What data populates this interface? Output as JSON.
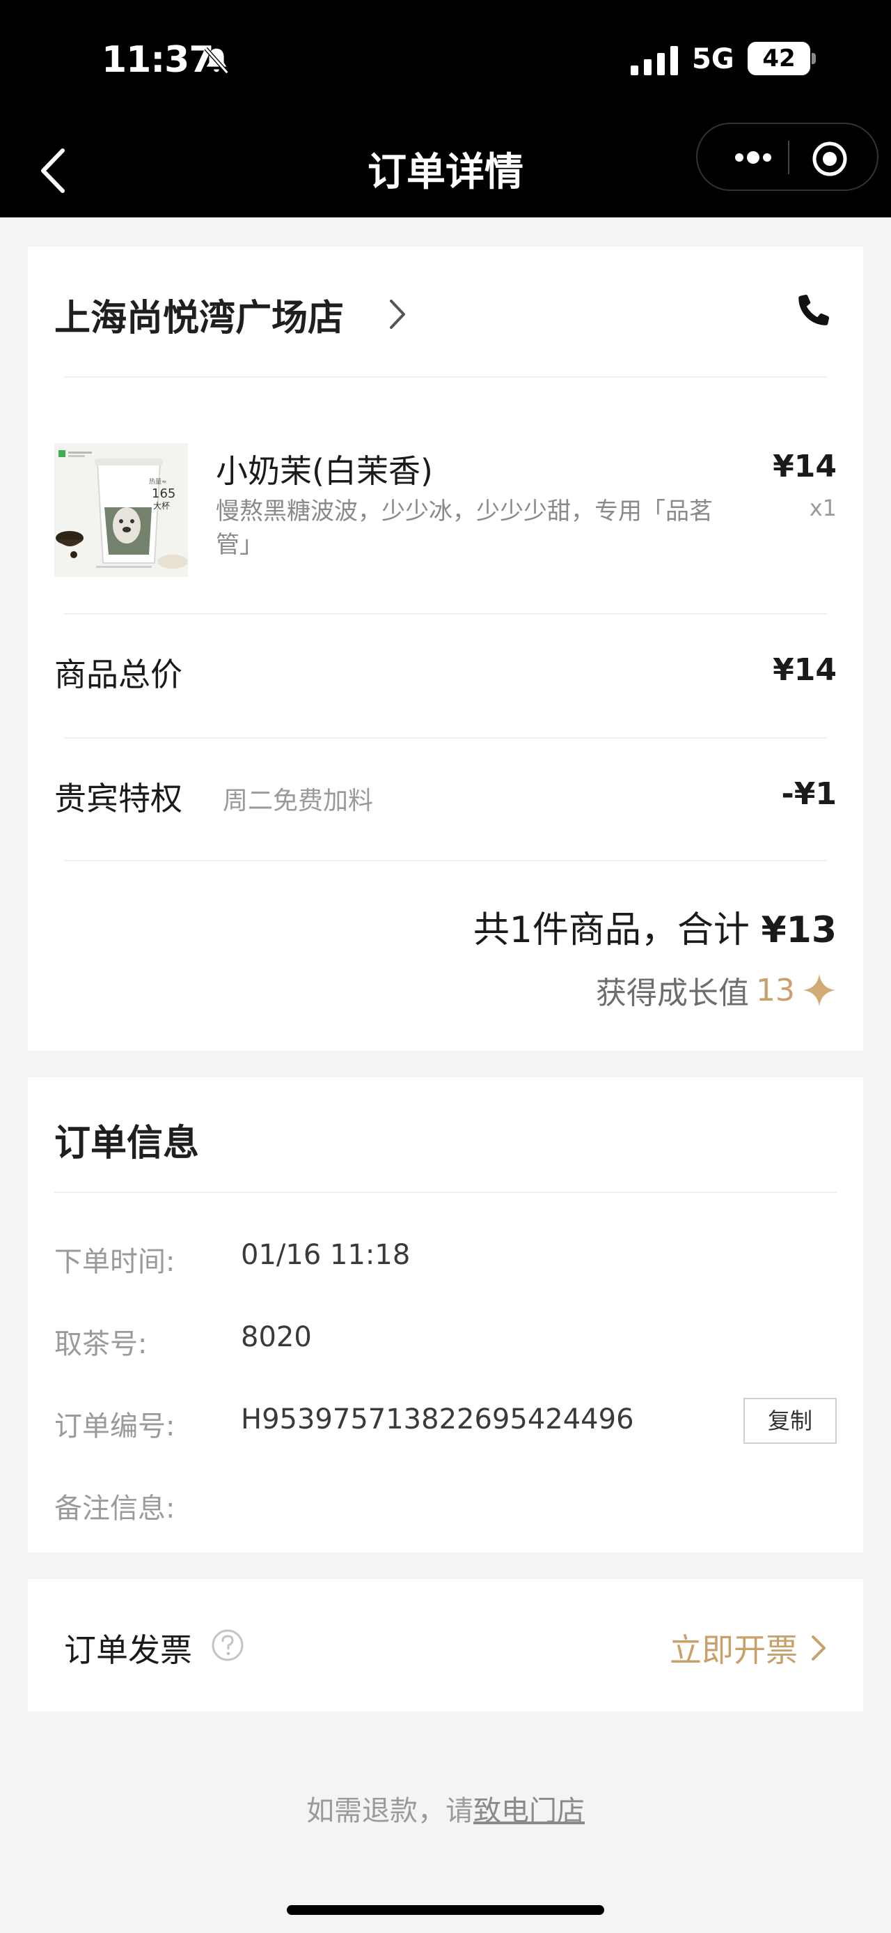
{
  "status_bar": {
    "time": "11:37",
    "network": "5G",
    "battery": "42"
  },
  "nav": {
    "title": "订单详情"
  },
  "store": {
    "name": "上海尚悦湾广场店"
  },
  "item": {
    "name": "小奶茉(白茉香)",
    "spec": "慢熬黑糖波波，少少冰，少少少甜，专用「品茗管」",
    "price": "¥14",
    "qty": "x1",
    "image_badge_volume": "165",
    "image_badge_size": "大杯"
  },
  "summary": {
    "subtotal_label": "商品总价",
    "subtotal_value": "¥14",
    "privilege_label": "贵宾特权",
    "privilege_desc": "周二免费加料",
    "privilege_value": "-¥1",
    "total_prefix": "共1件商品，合计 ",
    "total_amount": "¥13",
    "growth_label": "获得成长值",
    "growth_value": "13"
  },
  "order_info": {
    "title": "订单信息",
    "rows": [
      {
        "label": "下单时间:",
        "value": "01/16 11:18"
      },
      {
        "label": "取茶号:",
        "value": "8020"
      },
      {
        "label": "订单编号:",
        "value": "H953975713822695424496"
      },
      {
        "label": "备注信息:",
        "value": ""
      }
    ],
    "copy_label": "复制"
  },
  "invoice": {
    "label": "订单发票",
    "action_label": "立即开票"
  },
  "footer": {
    "refund_prefix": "如需退款，请",
    "refund_link": "致电门店"
  },
  "colors": {
    "accent_gold": "#c9a06a",
    "header_bg": "#000000",
    "page_bg": "#f4f4f4"
  },
  "icons": {
    "back": "chevron-left-icon",
    "more": "more-dots-icon",
    "close_target": "target-icon",
    "phone": "phone-icon",
    "help": "question-circle-icon",
    "sparkle": "sparkle-icon",
    "bell_muted": "bell-slash-icon"
  }
}
